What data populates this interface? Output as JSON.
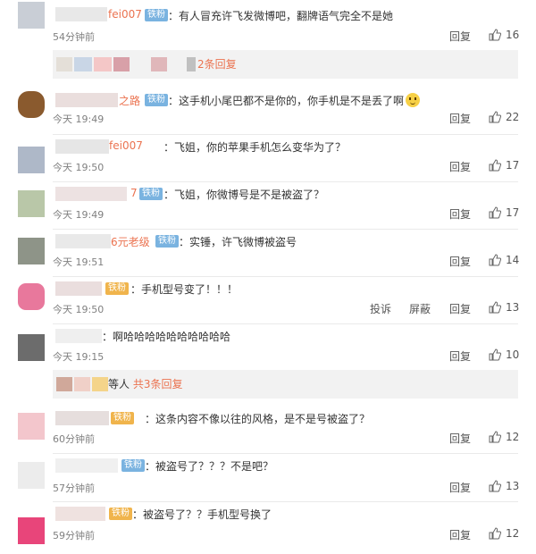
{
  "comments": [
    {
      "name": "fei007",
      "badge": "铁粉",
      "content": "有人冒充许飞发微博吧，翻牌语气完全不是她",
      "time": "54分钟前",
      "reply": "回复",
      "likes": "16"
    },
    {
      "name": "之路",
      "badge": "铁粉",
      "content": "这手机小尾巴都不是你的，你手机是不是丢了啊",
      "time": "今天 19:49",
      "reply": "回复",
      "likes": "22"
    },
    {
      "name": "fei007",
      "badge": "",
      "content": "飞姐，你的苹果手机怎么变华为了？",
      "time": "今天 19:50",
      "reply": "回复",
      "likes": "17"
    },
    {
      "name": "7",
      "badge": "铁粉",
      "content": "飞姐，你微博号是不是被盗了？",
      "time": "今天 19:49",
      "reply": "回复",
      "likes": "17"
    },
    {
      "name": "6元老级",
      "badge": "铁粉",
      "content": "实锤，许飞微博被盗号",
      "time": "今天 19:51",
      "reply": "回复",
      "likes": "14"
    },
    {
      "name": "",
      "badge": "铁粉",
      "content": "手机型号变了！！！",
      "time": "今天 19:50",
      "report": "投诉",
      "block": "屏蔽",
      "reply": "回复",
      "likes": "13"
    },
    {
      "name": "",
      "badge": "",
      "content": "啊哈哈哈哈哈哈哈哈哈哈",
      "time": "今天 19:15",
      "reply": "回复",
      "likes": "10"
    },
    {
      "name": "",
      "badge": "铁粉",
      "content": "这条内容不像以往的风格，是不是号被盗了？",
      "time": "60分钟前",
      "reply": "回复",
      "likes": "12"
    },
    {
      "name": "",
      "badge": "铁粉",
      "content": "被盗号了？？？不是吧？",
      "time": "57分钟前",
      "reply": "回复",
      "likes": "13"
    },
    {
      "name": "",
      "badge": "铁粉",
      "content": "被盗号了？？手机型号换了",
      "time": "59分钟前",
      "reply": "回复",
      "likes": "12"
    }
  ],
  "more_replies": [
    {
      "suffix": "",
      "text": "2条回复"
    },
    {
      "suffix": "等人",
      "text": "共3条回复"
    }
  ],
  "colors": {
    "link": "#eb7350",
    "badge": "#7ab3e0",
    "badge_gold": "#f0b44c",
    "panel": "#f2f2f2"
  }
}
